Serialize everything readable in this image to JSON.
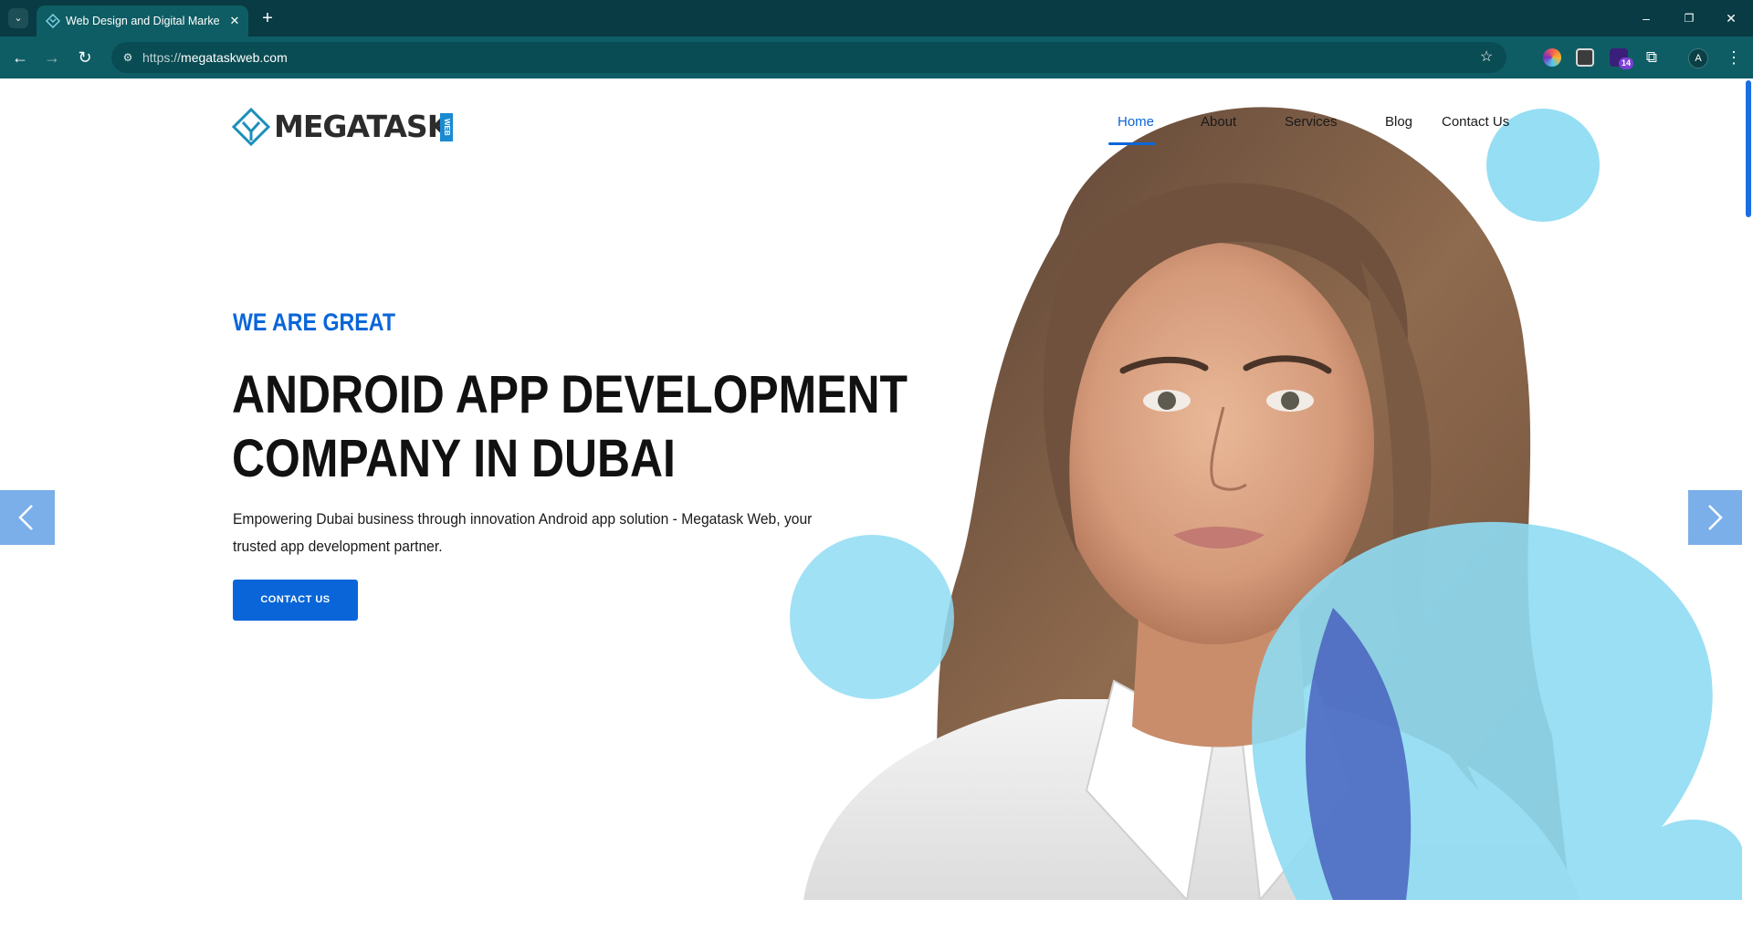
{
  "browser": {
    "tab": {
      "title": "Web Design and Digital Marketing"
    },
    "url": {
      "protocol": "https://",
      "host": "megataskweb.com"
    },
    "extension_badge": "14",
    "profile_initial": "A",
    "icons": [
      "tab-search-icon",
      "close-icon",
      "new-tab-icon",
      "minimize-icon",
      "restore-icon",
      "window-close-icon",
      "back-icon",
      "forward-icon",
      "reload-icon",
      "site-info-icon",
      "star-icon",
      "extension-icon",
      "puzzle-icon",
      "kebab-menu-icon"
    ]
  },
  "site": {
    "logo": {
      "text": "MEGATASK",
      "tag": "WEB"
    },
    "nav": [
      {
        "label": "Home",
        "active": true
      },
      {
        "label": "About",
        "active": false
      },
      {
        "label": "Services",
        "active": false
      },
      {
        "label": "Blog",
        "active": false
      },
      {
        "label": "Contact Us",
        "active": false
      }
    ],
    "hero": {
      "kicker": "WE ARE GREAT",
      "headline_line1": "ANDROID APP DEVELOPMENT",
      "headline_line2": "COMPANY IN DUBAI",
      "subtext": "Empowering Dubai business through innovation Android app solution - Megatask Web, your trusted app development partner.",
      "cta_label": "CONTACT US"
    }
  },
  "colors": {
    "browser_frame": "#083b43",
    "browser_toolbar": "#0f5d64",
    "accent_blue": "#0a66d8",
    "bubble_cyan": "#8fdcf3",
    "arrow_blue": "#6da7e8"
  }
}
